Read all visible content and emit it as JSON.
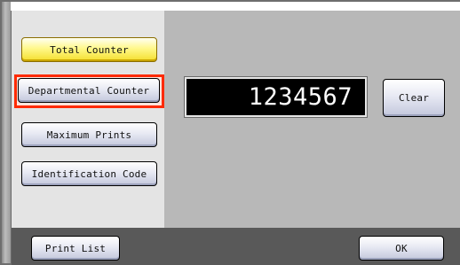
{
  "left_menu": {
    "items": [
      {
        "label": "Total Counter",
        "selected": true
      },
      {
        "label": "Departmental Counter",
        "selected": false,
        "highlighted": true
      },
      {
        "label": "Maximum Prints",
        "selected": false
      },
      {
        "label": "Identification Code",
        "selected": false
      }
    ]
  },
  "counter_display": {
    "value": "1234567"
  },
  "clear_button": {
    "label": "Clear"
  },
  "footer": {
    "print_list_label": "Print List",
    "ok_label": "OK"
  },
  "colors": {
    "selected_button": "#fff27a",
    "highlight_border": "#ff2a00",
    "display_bg": "#000000",
    "display_text": "#ffffff",
    "footer_bg": "#595959"
  }
}
